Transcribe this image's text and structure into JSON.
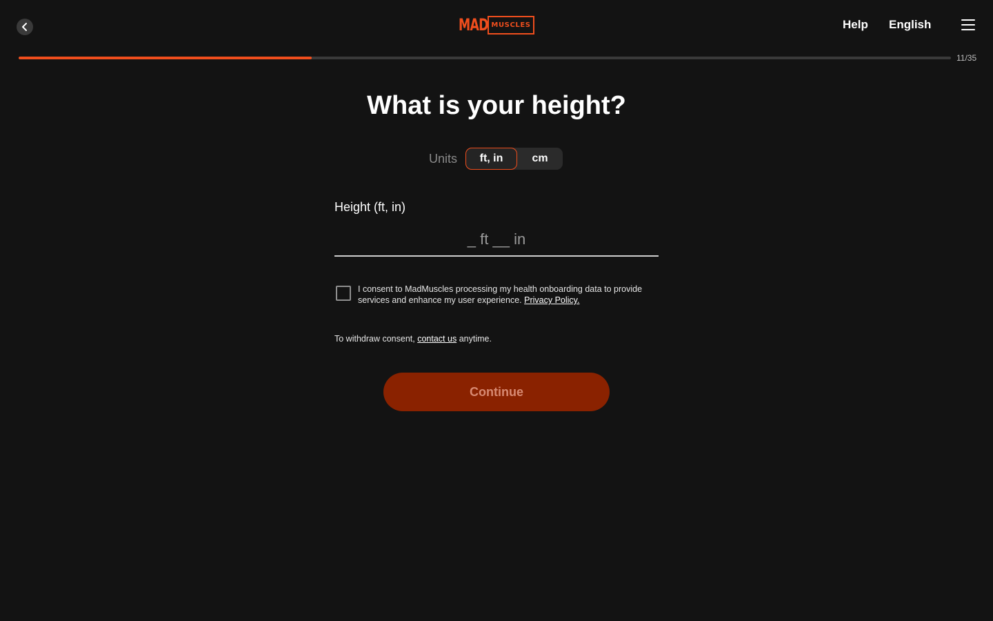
{
  "colors": {
    "accent": "#F04E1D",
    "background": "#131313",
    "continue_disabled": "#8A2200"
  },
  "header": {
    "back_icon": "chevron-left-icon",
    "logo": {
      "part1": "MAD",
      "part2": "MUSCLES"
    },
    "help_label": "Help",
    "language_label": "English",
    "menu_icon": "hamburger-menu-icon"
  },
  "progress": {
    "current": 11,
    "total": 35,
    "label": "11/35",
    "fill_fraction": 0.314
  },
  "main": {
    "title": "What is your height?",
    "units": {
      "label": "Units",
      "options": [
        "ft, in",
        "cm"
      ],
      "selected": "ft, in"
    },
    "field": {
      "label": "Height (ft, in)",
      "value": "",
      "placeholder": "_ ft __ in"
    },
    "consent": {
      "checked": false,
      "text": "I consent to MadMuscles processing my health onboarding data to provide services and enhance my user experience.",
      "link_label": "Privacy Policy."
    },
    "withdraw": {
      "prefix": "To withdraw consent,",
      "link_label": "contact us",
      "suffix": "anytime."
    },
    "continue_label": "Continue"
  }
}
